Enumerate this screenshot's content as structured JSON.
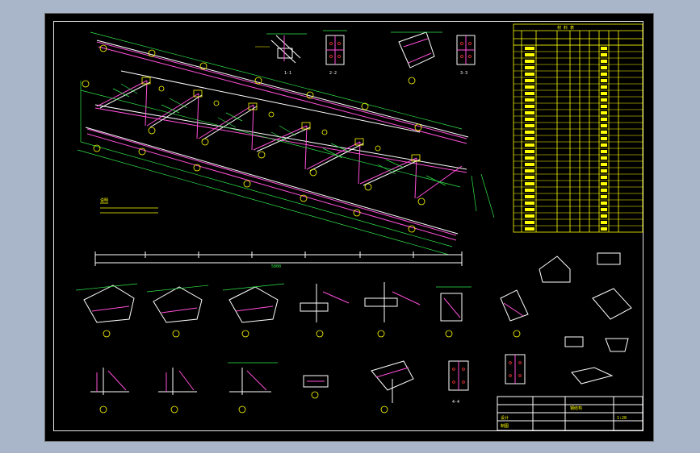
{
  "drawing": {
    "view_labels": [
      "1-1",
      "2-2",
      "3-3",
      "4-4"
    ],
    "section_numbers": [
      "1",
      "2",
      "3",
      "4",
      "5",
      "6",
      "7",
      "8",
      "9",
      "10",
      "11",
      "12",
      "13",
      "14",
      "15"
    ],
    "notes": "说明",
    "dims": {
      "overall": "5000",
      "span": "1200"
    }
  },
  "colors": {
    "background": "#000000",
    "frame": "#ffffff",
    "member": "#ff4fd8",
    "dimension": "#31e84b",
    "table": "#ffff00",
    "bolt": "#ff3a3a"
  },
  "table": {
    "title": "材 料 表",
    "headers": [
      "编号",
      "规格",
      "长度",
      "数量",
      "单重",
      "共重",
      "备注"
    ]
  },
  "title_block": {
    "labels": [
      "设计",
      "制图",
      "校对",
      "审核"
    ],
    "scale": "1:20",
    "sheet": "钢结构"
  }
}
